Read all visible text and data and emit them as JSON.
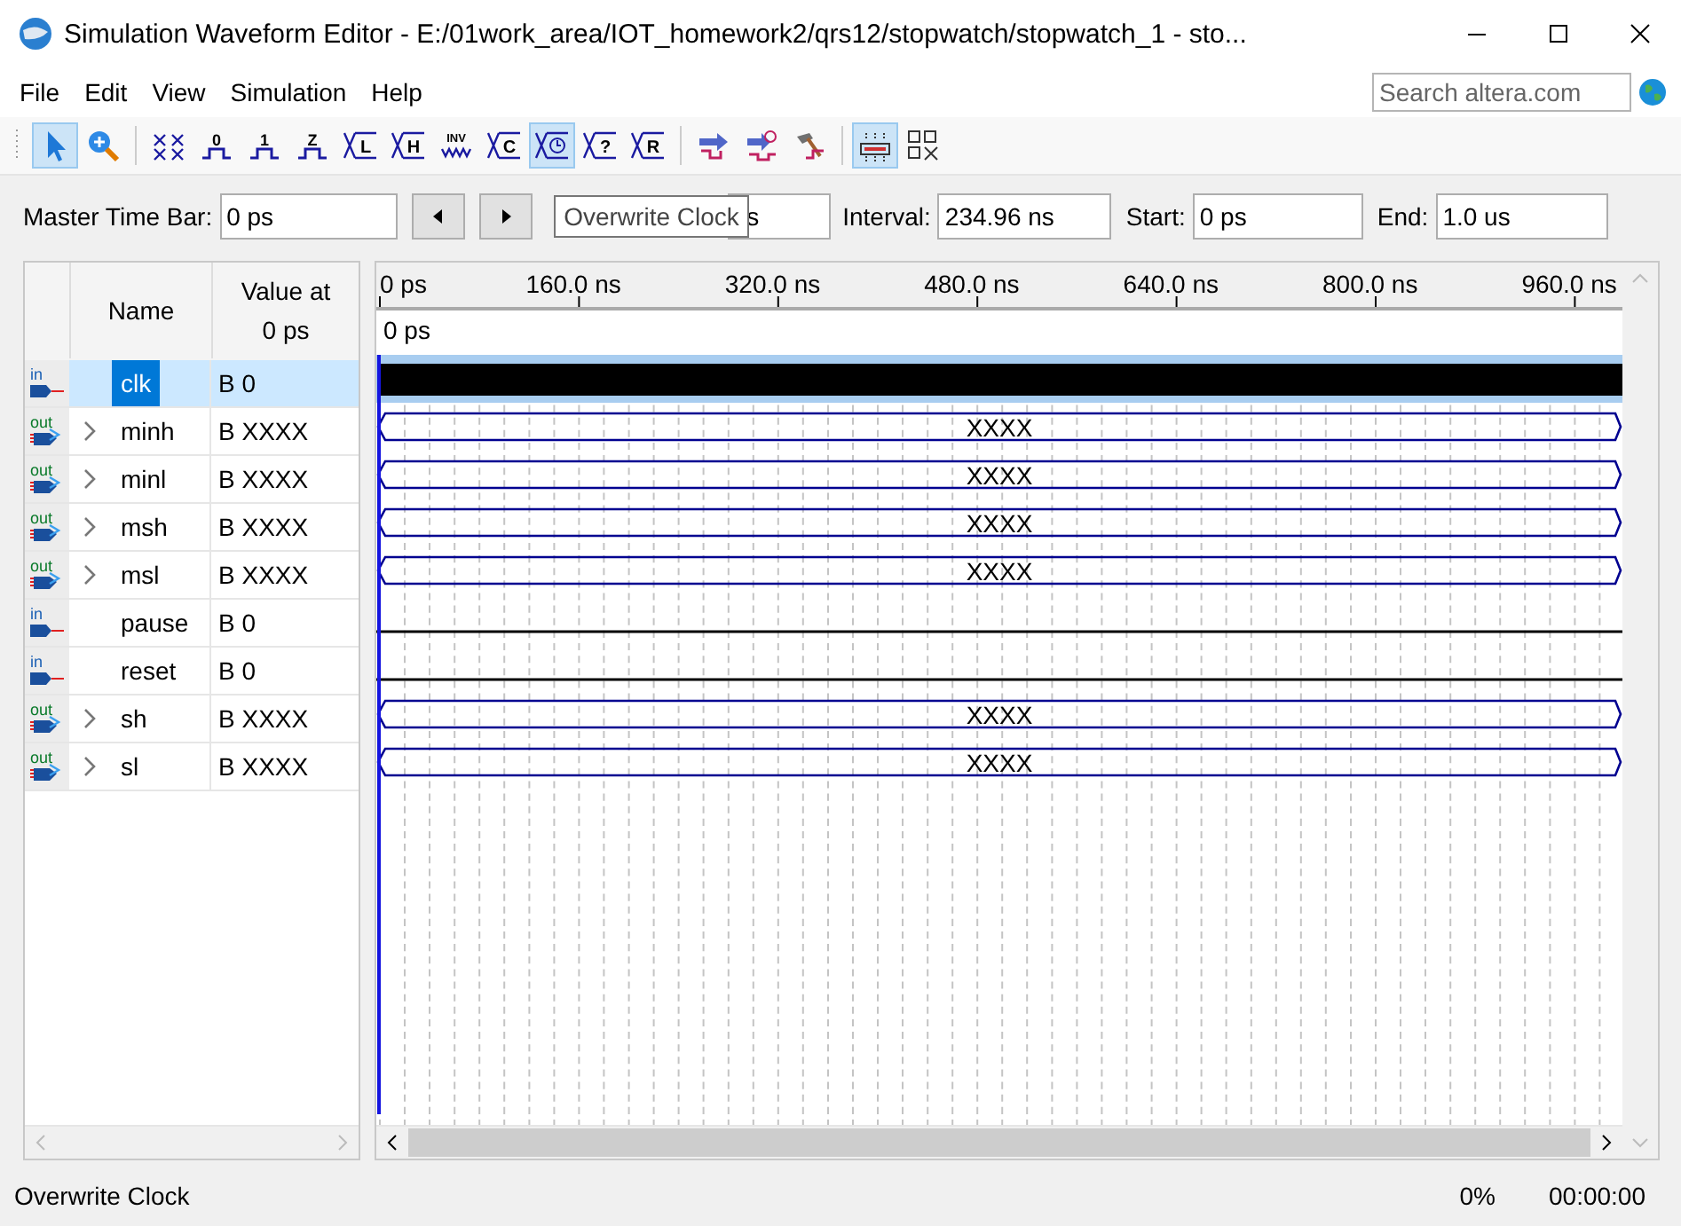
{
  "window": {
    "title": "Simulation Waveform Editor - E:/01work_area/IOT_homework2/qrs12/stopwatch/stopwatch_1 - sto..."
  },
  "menu": [
    "File",
    "Edit",
    "View",
    "Simulation",
    "Help"
  ],
  "search": {
    "placeholder": "Search altera.com"
  },
  "toolbar": [
    {
      "kind": "pointer",
      "selected": true
    },
    {
      "kind": "zoom",
      "selected": false
    },
    {
      "kind": "separator"
    },
    {
      "kind": "unknown",
      "selected": false
    },
    {
      "kind": "level",
      "glyph": "0",
      "selected": false
    },
    {
      "kind": "level",
      "glyph": "1",
      "selected": false
    },
    {
      "kind": "level",
      "glyph": "Z",
      "selected": false
    },
    {
      "kind": "bus",
      "glyph": "L",
      "selected": false
    },
    {
      "kind": "bus",
      "glyph": "H",
      "selected": false
    },
    {
      "kind": "invert",
      "glyph": "INV",
      "selected": false
    },
    {
      "kind": "bus",
      "glyph": "C",
      "selected": false
    },
    {
      "kind": "clock",
      "selected": true
    },
    {
      "kind": "bus",
      "glyph": "?",
      "selected": false
    },
    {
      "kind": "bus",
      "glyph": "R",
      "selected": false
    },
    {
      "kind": "separator"
    },
    {
      "kind": "node-finder",
      "selected": false
    },
    {
      "kind": "node-list",
      "selected": false
    },
    {
      "kind": "hammer",
      "selected": false
    },
    {
      "kind": "separator"
    },
    {
      "kind": "snap",
      "selected": true
    },
    {
      "kind": "grid",
      "selected": false
    }
  ],
  "time_bar": {
    "master_label": "Master Time Bar:",
    "master_value": "0 ps",
    "pointer_value": "s",
    "tooltip": "Overwrite Clock",
    "interval_label": "Interval:",
    "interval_value": "234.96 ns",
    "start_label": "Start:",
    "start_value": "0 ps",
    "end_label": "End:",
    "end_value": "1.0 us"
  },
  "table": {
    "columns": [
      "Name",
      "Value at 0 ps"
    ],
    "rows": [
      {
        "kind": "input",
        "pin_label": "in",
        "name": "clk",
        "value": "B 0",
        "expandable": false,
        "selected": true,
        "waveform": {
          "kind": "clock"
        }
      },
      {
        "kind": "output",
        "pin_label": "out",
        "name": "minh",
        "value": "B XXXX",
        "expandable": true,
        "selected": false,
        "waveform": {
          "kind": "bus",
          "label": "XXXX"
        }
      },
      {
        "kind": "output",
        "pin_label": "out",
        "name": "minl",
        "value": "B XXXX",
        "expandable": true,
        "selected": false,
        "waveform": {
          "kind": "bus",
          "label": "XXXX"
        }
      },
      {
        "kind": "output",
        "pin_label": "out",
        "name": "msh",
        "value": "B XXXX",
        "expandable": true,
        "selected": false,
        "waveform": {
          "kind": "bus",
          "label": "XXXX"
        }
      },
      {
        "kind": "output",
        "pin_label": "out",
        "name": "msl",
        "value": "B XXXX",
        "expandable": true,
        "selected": false,
        "waveform": {
          "kind": "bus",
          "label": "XXXX"
        }
      },
      {
        "kind": "input",
        "pin_label": "in",
        "name": "pause",
        "value": "B 0",
        "expandable": false,
        "selected": false,
        "waveform": {
          "kind": "low"
        }
      },
      {
        "kind": "input",
        "pin_label": "in",
        "name": "reset",
        "value": "B 0",
        "expandable": false,
        "selected": false,
        "waveform": {
          "kind": "low"
        }
      },
      {
        "kind": "output",
        "pin_label": "out",
        "name": "sh",
        "value": "B XXXX",
        "expandable": true,
        "selected": false,
        "waveform": {
          "kind": "bus",
          "label": "XXXX"
        }
      },
      {
        "kind": "output",
        "pin_label": "out",
        "name": "sl",
        "value": "B XXXX",
        "expandable": true,
        "selected": false,
        "waveform": {
          "kind": "bus",
          "label": "XXXX"
        }
      }
    ]
  },
  "ruler": {
    "ticks": [
      "0 ps",
      "160.0 ns",
      "320.0 ns",
      "480.0 ns",
      "640.0 ns",
      "800.0 ns",
      "960.0 ns"
    ],
    "cursor_label": "0 ps"
  },
  "status_bar": {
    "message": "Overwrite Clock",
    "progress": "0%",
    "elapsed": "00:00:00"
  }
}
